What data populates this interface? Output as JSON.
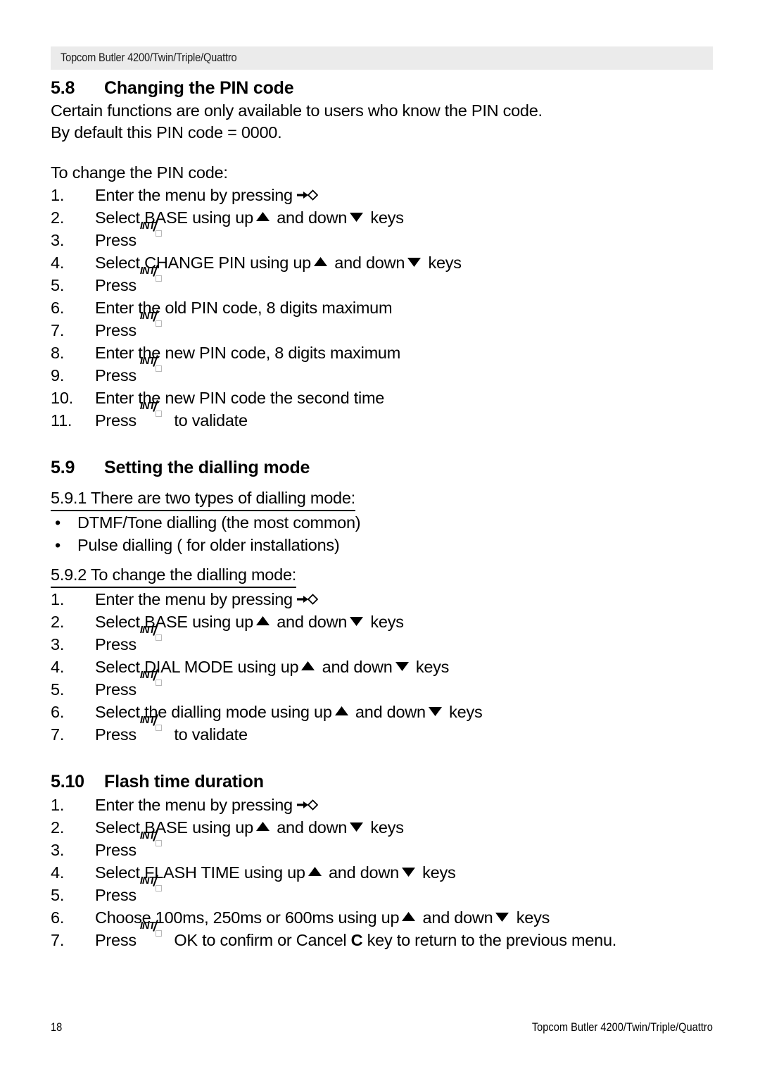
{
  "header": {
    "running_title": "Topcom Butler 4200/Twin/Triple/Quattro",
    "background_color": "#ebebeb"
  },
  "icons": {
    "menu_key": "menu-arrow-icon",
    "up_key": "up-triangle-icon",
    "down_key": "down-triangle-icon",
    "int_key": "int-key-icon"
  },
  "sections": [
    {
      "number": "5.8",
      "title": "Changing the PIN code",
      "paragraphs": [
        "Certain functions are only available to users who know the PIN code.",
        "By default this PIN code = 0000."
      ],
      "lead_in": "To change the PIN code:",
      "steps": [
        {
          "n": "1.",
          "before": "Enter the menu by pressing",
          "icon": "menu",
          "after": ""
        },
        {
          "n": "2.",
          "before": "Select BASE using up",
          "icon": "updown",
          "mid": "and down",
          "after": "keys"
        },
        {
          "n": "3.",
          "before": "Press",
          "icon": "int",
          "after": ""
        },
        {
          "n": "4.",
          "before": "Select CHANGE PIN using up",
          "icon": "updown",
          "mid": "and down",
          "after": "keys"
        },
        {
          "n": "5.",
          "before": "Press",
          "icon": "int",
          "after": ""
        },
        {
          "n": "6.",
          "before": "Enter the old PIN code, 8 digits maximum",
          "icon": "none",
          "after": ""
        },
        {
          "n": "7.",
          "before": "Press",
          "icon": "int",
          "after": ""
        },
        {
          "n": "8.",
          "before": "Enter the new PIN code, 8 digits maximum",
          "icon": "none",
          "after": ""
        },
        {
          "n": "9.",
          "before": "Press",
          "icon": "int",
          "after": ""
        },
        {
          "n": "10.",
          "before": "Enter the new PIN code the second time",
          "icon": "none",
          "after": ""
        },
        {
          "n": "11.",
          "before": "Press",
          "icon": "int",
          "after": "to validate"
        }
      ]
    },
    {
      "number": "5.9",
      "title": "Setting the dialling mode",
      "sub1_heading": "5.9.1 There are two types of dialling mode:",
      "bullets": [
        "DTMF/Tone dialling (the most common)",
        "Pulse dialling ( for older installations)"
      ],
      "sub2_heading": "5.9.2 To change the dialling mode:",
      "steps": [
        {
          "n": "1.",
          "before": "Enter the menu by pressing",
          "icon": "menu",
          "after": ""
        },
        {
          "n": "2.",
          "before": "Select BASE using up",
          "icon": "updown",
          "mid": "and down",
          "after": "keys"
        },
        {
          "n": "3.",
          "before": "Press",
          "icon": "int",
          "after": ""
        },
        {
          "n": "4.",
          "before": "Select DIAL MODE using up",
          "icon": "updown",
          "mid": "and down",
          "after": "keys"
        },
        {
          "n": "5.",
          "before": "Press",
          "icon": "int",
          "after": ""
        },
        {
          "n": "6.",
          "before": "Select the dialling mode using up",
          "icon": "updown",
          "mid": "and down",
          "after": "keys"
        },
        {
          "n": "7.",
          "before": "Press",
          "icon": "int",
          "after": "to validate"
        }
      ]
    },
    {
      "number": "5.10",
      "title": "Flash time duration",
      "steps": [
        {
          "n": "1.",
          "before": "Enter the menu by pressing",
          "icon": "menu",
          "after": ""
        },
        {
          "n": "2.",
          "before": "Select BASE using up",
          "icon": "updown",
          "mid": "and down",
          "after": "keys"
        },
        {
          "n": "3.",
          "before": "Press",
          "icon": "int",
          "after": ""
        },
        {
          "n": "4.",
          "before": "Select FLASH TIME using up",
          "icon": "updown",
          "mid": "and down",
          "after": "keys"
        },
        {
          "n": "5.",
          "before": "Press",
          "icon": "int",
          "after": ""
        },
        {
          "n": "6.",
          "before": "Choose 100ms, 250ms or 600ms using up",
          "icon": "updown",
          "mid": "and down",
          "after": "keys"
        },
        {
          "n": "7.",
          "before": "Press",
          "icon": "int",
          "after_a": "OK to confirm or Cancel",
          "bold": "C",
          "after_b": "key  to return to the previous menu."
        }
      ]
    }
  ],
  "footer": {
    "page_number": "18",
    "document_title": "Topcom Butler 4200/Twin/Triple/Quattro"
  }
}
